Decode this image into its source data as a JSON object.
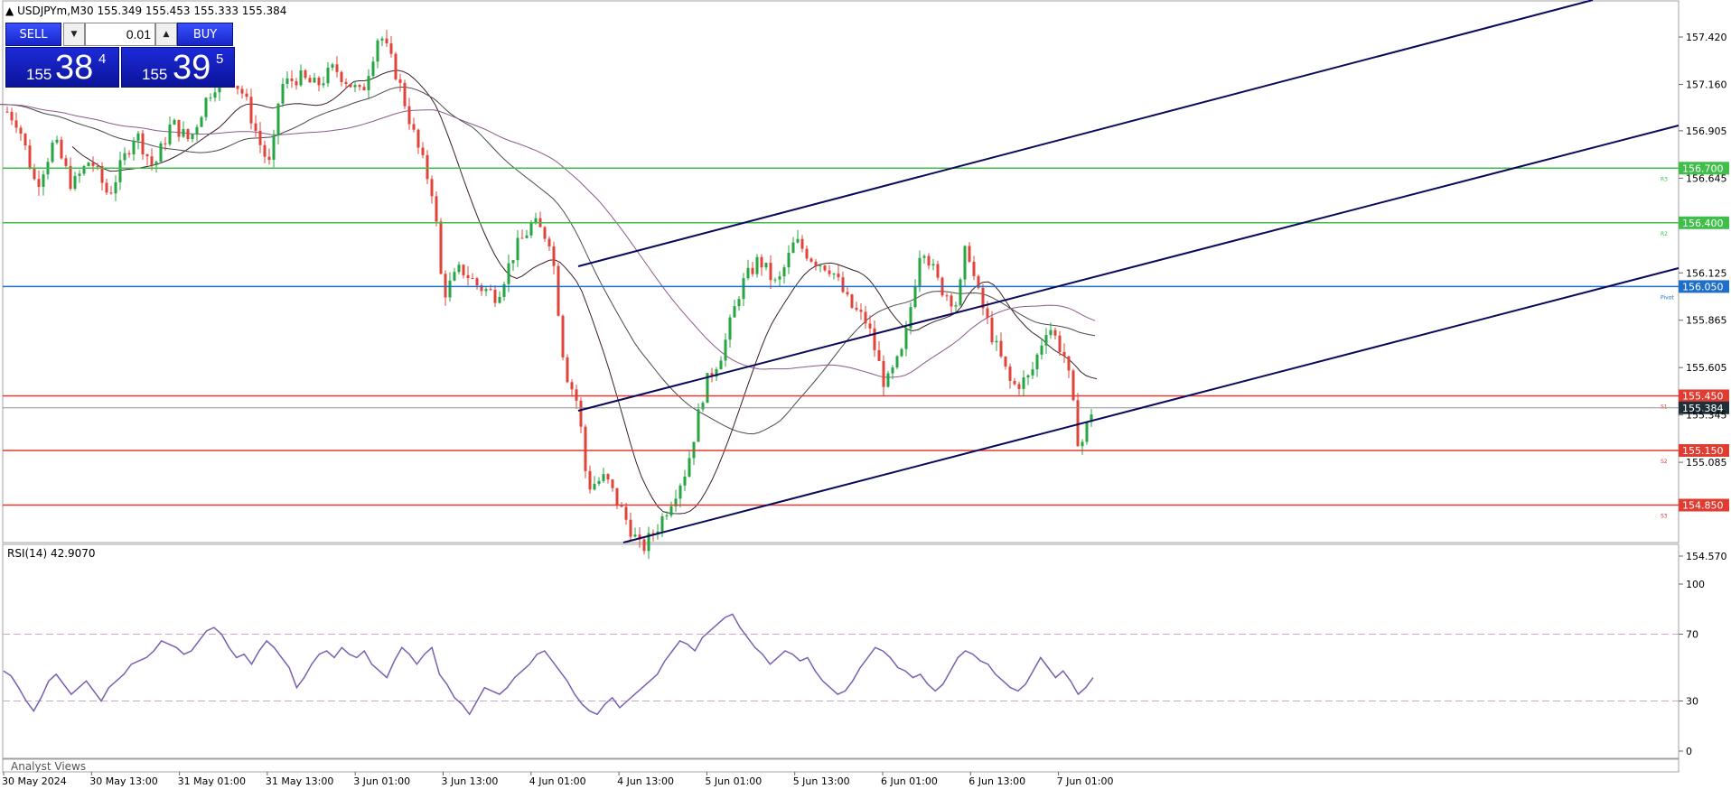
{
  "header": {
    "symbol_line": "USDJPYm,M30  155.349 155.453 155.333 155.384"
  },
  "trade_panel": {
    "sell_label": "SELL",
    "buy_label": "BUY",
    "lot": "0.01",
    "down_icon": "▼",
    "up_icon": "▲",
    "sell_price": {
      "prefix": "155",
      "big": "38",
      "sup": "4"
    },
    "buy_price": {
      "prefix": "155",
      "big": "39",
      "sup": "5"
    }
  },
  "price_axis": {
    "ticks": [
      "157.420",
      "157.160",
      "156.905",
      "156.645",
      "156.125",
      "155.865",
      "155.605",
      "155.345",
      "155.085",
      "154.570"
    ],
    "current_price": "155.384"
  },
  "levels": [
    {
      "key": "R3",
      "value": "156.700",
      "label": "R3",
      "color": "#3fbf4a"
    },
    {
      "key": "R2",
      "value": "156.400",
      "label": "R2",
      "color": "#3fbf4a"
    },
    {
      "key": "Pivot",
      "value": "156.050",
      "label": "Pivot",
      "color": "#1f6fc8"
    },
    {
      "key": "S1",
      "value": "155.450",
      "label": "S1",
      "color": "#e03c31"
    },
    {
      "key": "S2",
      "value": "155.150",
      "label": "S2",
      "color": "#e03c31"
    },
    {
      "key": "S3",
      "value": "154.850",
      "label": "S3",
      "color": "#e03c31"
    }
  ],
  "time_axis": {
    "labels": [
      "30 May 2024",
      "30 May 13:00",
      "31 May 01:00",
      "31 May 13:00",
      "3 Jun 01:00",
      "3 Jun 13:00",
      "4 Jun 01:00",
      "4 Jun 13:00",
      "5 Jun 01:00",
      "5 Jun 13:00",
      "6 Jun 01:00",
      "6 Jun 13:00",
      "7 Jun 01:00"
    ]
  },
  "rsi": {
    "header": "RSI(14) 42.9070",
    "ticks": [
      "100",
      "70",
      "30",
      "0"
    ],
    "values": [
      48,
      45,
      38,
      30,
      24,
      32,
      42,
      46,
      40,
      34,
      38,
      42,
      36,
      30,
      38,
      42,
      46,
      52,
      54,
      56,
      60,
      66,
      64,
      62,
      58,
      60,
      66,
      72,
      74,
      70,
      62,
      56,
      58,
      52,
      60,
      66,
      62,
      56,
      50,
      38,
      44,
      52,
      58,
      60,
      56,
      62,
      58,
      56,
      60,
      52,
      48,
      44,
      54,
      62,
      58,
      52,
      58,
      62,
      46,
      40,
      32,
      28,
      22,
      30,
      38,
      36,
      34,
      38,
      44,
      48,
      52,
      58,
      60,
      54,
      48,
      42,
      34,
      28,
      24,
      22,
      28,
      32,
      26,
      30,
      34,
      38,
      42,
      46,
      54,
      60,
      66,
      64,
      60,
      68,
      72,
      76,
      80,
      82,
      74,
      68,
      62,
      58,
      52,
      56,
      60,
      58,
      54,
      56,
      48,
      42,
      38,
      34,
      36,
      42,
      50,
      56,
      62,
      60,
      56,
      50,
      48,
      44,
      46,
      40,
      36,
      40,
      48,
      56,
      60,
      58,
      54,
      52,
      46,
      42,
      38,
      36,
      40,
      48,
      56,
      50,
      44,
      48,
      42,
      34,
      38,
      44
    ]
  },
  "footer": {
    "analyst_tab": "Analyst Views"
  },
  "colors": {
    "bull": "#26a641",
    "bear": "#e0433a",
    "channel": "#0a0a5a",
    "ma_dark": "#3a1f2a",
    "ma_mid": "#4a4a4a",
    "ma_purple": "#8c5a8c",
    "rsi_line": "#7a5fb0",
    "current_bg": "#20303a"
  }
}
